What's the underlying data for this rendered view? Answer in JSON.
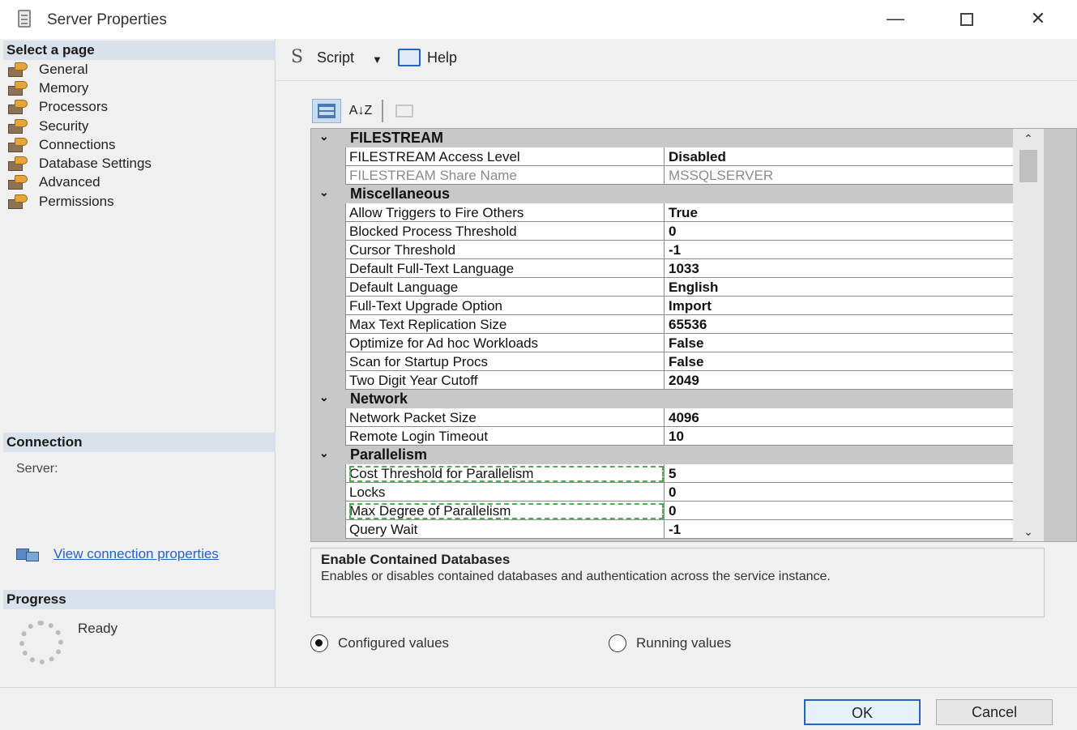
{
  "window": {
    "title": "Server Properties",
    "minimize": "—",
    "maximize": "",
    "close": "✕"
  },
  "left": {
    "select_header": "Select a page",
    "pages": [
      "General",
      "Memory",
      "Processors",
      "Security",
      "Connections",
      "Database Settings",
      "Advanced",
      "Permissions"
    ],
    "connection_header": "Connection",
    "server_label": "Server:",
    "view_connection_link": "View connection properties",
    "progress_header": "Progress",
    "progress_status": "Ready"
  },
  "toolbar": {
    "script_label": "Script",
    "dropdown_arrow": "▼",
    "help_label": "Help"
  },
  "propbar": {
    "sort_alpha_label": "A↓Z"
  },
  "grid": {
    "categories": [
      {
        "name": "FILESTREAM",
        "chevron": "⌄",
        "rows": [
          {
            "name": "FILESTREAM Access Level",
            "value": "Disabled",
            "disabled": false
          },
          {
            "name": "FILESTREAM Share Name",
            "value": "MSSQLSERVER",
            "disabled": true
          }
        ]
      },
      {
        "name": "Miscellaneous",
        "chevron": "⌄",
        "rows": [
          {
            "name": "Allow Triggers to Fire Others",
            "value": "True"
          },
          {
            "name": "Blocked Process Threshold",
            "value": "0"
          },
          {
            "name": "Cursor Threshold",
            "value": "-1"
          },
          {
            "name": "Default Full-Text Language",
            "value": "1033"
          },
          {
            "name": "Default Language",
            "value": "English"
          },
          {
            "name": "Full-Text Upgrade Option",
            "value": "Import"
          },
          {
            "name": "Max Text Replication Size",
            "value": "65536"
          },
          {
            "name": "Optimize for Ad hoc Workloads",
            "value": "False"
          },
          {
            "name": "Scan for Startup Procs",
            "value": "False"
          },
          {
            "name": "Two Digit Year Cutoff",
            "value": "2049"
          }
        ]
      },
      {
        "name": "Network",
        "chevron": "⌄",
        "rows": [
          {
            "name": "Network Packet Size",
            "value": "4096"
          },
          {
            "name": "Remote Login Timeout",
            "value": "10"
          }
        ]
      },
      {
        "name": "Parallelism",
        "chevron": "⌄",
        "rows": [
          {
            "name": "Cost Threshold for Parallelism",
            "value": "5",
            "highlight": true
          },
          {
            "name": "Locks",
            "value": "0"
          },
          {
            "name": "Max Degree of Parallelism",
            "value": "0",
            "highlight": true
          },
          {
            "name": "Query Wait",
            "value": "-1"
          }
        ]
      }
    ],
    "scroll_up": "⌃",
    "scroll_down": "⌄"
  },
  "description": {
    "title": "Enable Contained Databases",
    "text": "Enables or disables contained databases and authentication across the service instance."
  },
  "radios": {
    "configured": "Configured values",
    "running": "Running values",
    "selected": "configured"
  },
  "footer": {
    "ok": "OK",
    "cancel": "Cancel"
  }
}
